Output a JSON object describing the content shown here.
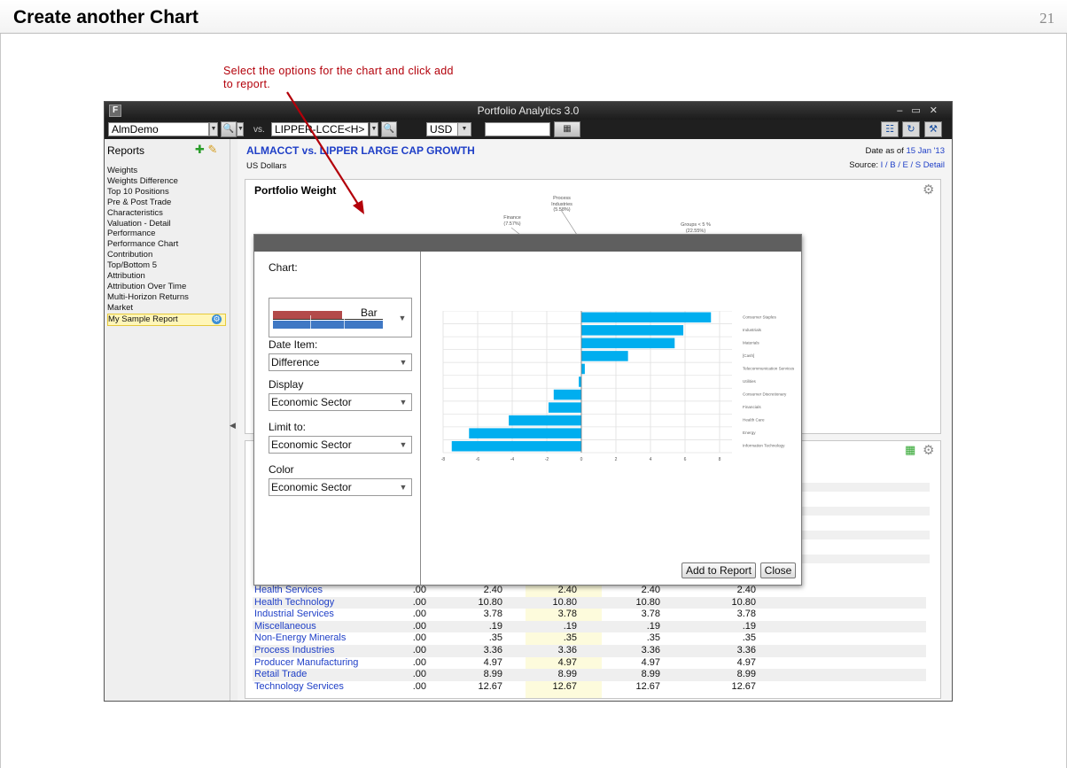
{
  "slide": {
    "title": "Create another Chart",
    "page_number": "21",
    "callout": "Select the options for the chart and click add to report."
  },
  "window": {
    "title": "Portfolio Analytics 3.0",
    "logo": "F",
    "portfolio_value": "AlmDemo",
    "vs_label": "vs.",
    "benchmark_value": "LIPPER-LCCE<H>",
    "currency_value": "USD"
  },
  "sidebar": {
    "header": "Reports",
    "items": [
      {
        "label": "Weights"
      },
      {
        "label": "Weights Difference"
      },
      {
        "label": "Top 10 Positions"
      },
      {
        "label": "Pre & Post Trade"
      },
      {
        "label": "Characteristics"
      },
      {
        "label": "Valuation - Detail"
      },
      {
        "label": "Performance"
      },
      {
        "label": "Performance Chart"
      },
      {
        "label": "Contribution"
      },
      {
        "label": "Top/Bottom 5"
      },
      {
        "label": "Attribution"
      },
      {
        "label": "Attribution Over Time"
      },
      {
        "label": "Multi-Horizon Returns"
      },
      {
        "label": "Market"
      },
      {
        "label": "My Sample Report"
      }
    ],
    "selected": "My Sample Report"
  },
  "report": {
    "title": "ALMACCT vs. LIPPER LARGE CAP GROWTH",
    "currency": "US Dollars",
    "date_prefix": "Date as of",
    "date_value": "15 Jan '13",
    "source_prefix": "Source:",
    "source_links": "I / B / E / S Detail",
    "panel_title": "Portfolio Weight",
    "pie_labels": [
      {
        "text": "Process Industries (5.58%)"
      },
      {
        "text": "Finance (7.57%)"
      },
      {
        "text": "Groups < 5 % (22.55%)"
      }
    ]
  },
  "table": {
    "rows": [
      {
        "name": "Health Services",
        "c1": ".00",
        "c2": "2.40",
        "c3": "2.40",
        "c4": "2.40",
        "c5": "2.40"
      },
      {
        "name": "Health Technology",
        "c1": ".00",
        "c2": "10.80",
        "c3": "10.80",
        "c4": "10.80",
        "c5": "10.80"
      },
      {
        "name": "Industrial Services",
        "c1": ".00",
        "c2": "3.78",
        "c3": "3.78",
        "c4": "3.78",
        "c5": "3.78"
      },
      {
        "name": "Miscellaneous",
        "c1": ".00",
        "c2": ".19",
        "c3": ".19",
        "c4": ".19",
        "c5": ".19"
      },
      {
        "name": "Non-Energy Minerals",
        "c1": ".00",
        "c2": ".35",
        "c3": ".35",
        "c4": ".35",
        "c5": ".35"
      },
      {
        "name": "Process Industries",
        "c1": ".00",
        "c2": "3.36",
        "c3": "3.36",
        "c4": "3.36",
        "c5": "3.36"
      },
      {
        "name": "Producer Manufacturing",
        "c1": ".00",
        "c2": "4.97",
        "c3": "4.97",
        "c4": "4.97",
        "c5": "4.97"
      },
      {
        "name": "Retail Trade",
        "c1": ".00",
        "c2": "8.99",
        "c3": "8.99",
        "c4": "8.99",
        "c5": "8.99"
      },
      {
        "name": "Technology Services",
        "c1": ".00",
        "c2": "12.67",
        "c3": "12.67",
        "c4": "12.67",
        "c5": "12.67"
      }
    ]
  },
  "dialog": {
    "chart_label": "Chart:",
    "chart_type_value": "Bar",
    "date_item_label": "Date Item:",
    "date_item_value": "Difference",
    "display_label": "Display",
    "display_value": "Economic Sector",
    "limit_label": "Limit to:",
    "limit_value": "Economic Sector",
    "color_label": "Color",
    "color_value": "Economic Sector",
    "add_button": "Add to Report",
    "close_button": "Close"
  },
  "chart_data": {
    "type": "bar",
    "orientation": "horizontal",
    "categories": [
      "Consumer Staples",
      "Industrials",
      "Materials",
      "[Cash]",
      "Telecommunication Services",
      "Utilities",
      "Consumer Discretionary",
      "Financials",
      "Health Care",
      "Energy",
      "Information Technology"
    ],
    "values": [
      7.5,
      5.9,
      5.4,
      2.7,
      0.2,
      -0.15,
      -1.6,
      -1.9,
      -4.2,
      -6.5,
      -7.5
    ],
    "xlim": [
      -8,
      8
    ],
    "xticks": [
      "-8",
      "-6",
      "-4",
      "-2",
      "0",
      "2",
      "4",
      "6",
      "8"
    ],
    "color": "#00aeef",
    "grid": true
  },
  "colors": {
    "accent_blue": "#1f3fc7",
    "callout_red": "#b3000a",
    "bar_blue": "#00aeef",
    "selected_item": "#fff6b8"
  }
}
